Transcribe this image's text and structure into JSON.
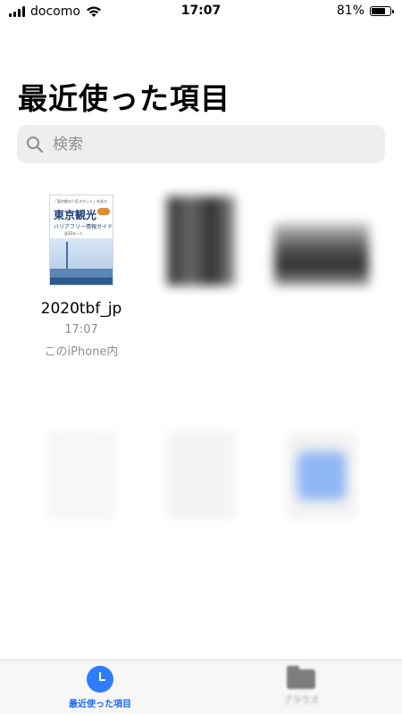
{
  "status_bar": {
    "carrier": "docomo",
    "time": "17:07",
    "battery": "81%",
    "battery_level": 0.81
  },
  "page": {
    "title": "最近使った項目"
  },
  "search": {
    "placeholder": "検索"
  },
  "files": [
    {
      "name": "2020tbf_jp",
      "time": "17:07",
      "location": "このiPhone内",
      "thumbnail": "document-preview",
      "thumb_text": {
        "header": "「東京都の人気スポット」を巡る",
        "title": "東京観光",
        "subtitle": "バリアフリー情報ガイド",
        "count": "全33ルート"
      }
    },
    {
      "name": "",
      "time": "",
      "location": "",
      "thumbnail": "blurred-photo"
    },
    {
      "name": "",
      "time": "",
      "location": "",
      "thumbnail": "blurred-photo"
    },
    {
      "name": "",
      "time": "",
      "location": "",
      "thumbnail": "blurred-document"
    },
    {
      "name": "",
      "time": "",
      "location": "",
      "thumbnail": "blurred-document"
    },
    {
      "name": "",
      "time": "",
      "location": "",
      "thumbnail": "blurred-image-icon"
    }
  ],
  "tabbar": {
    "recent_label": "最近使った項目",
    "browse_label": "ブラウズ",
    "accent_color": "#2f7dff"
  }
}
